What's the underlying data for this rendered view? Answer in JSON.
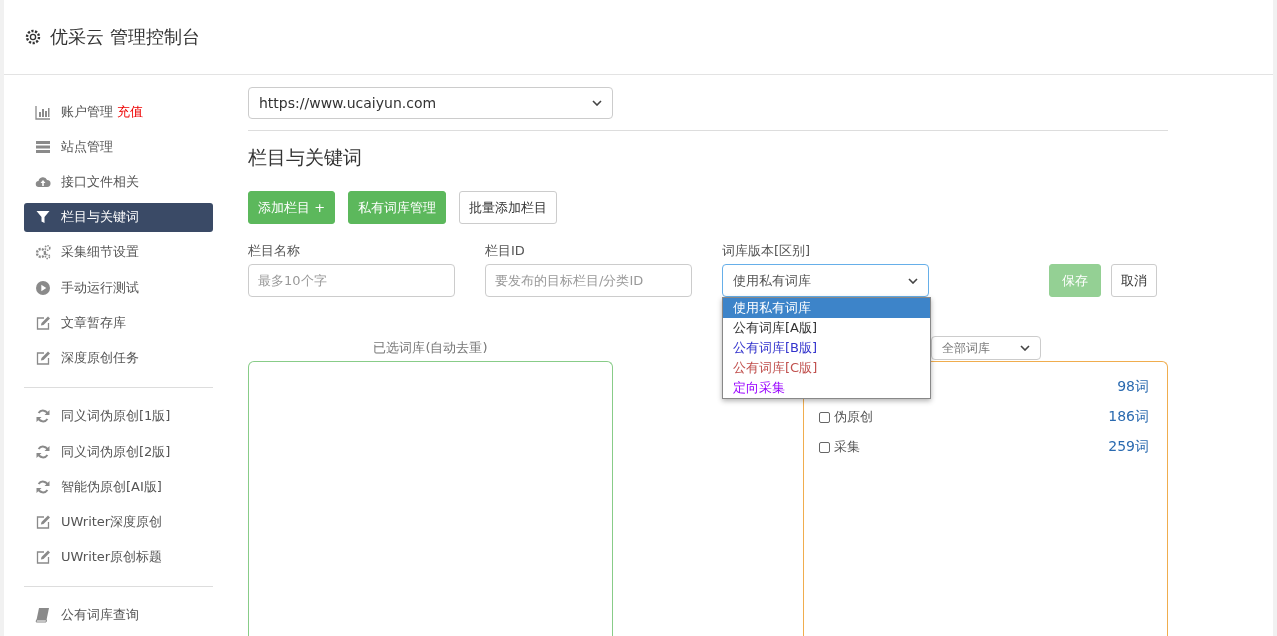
{
  "header": {
    "title": "优采云 管理控制台"
  },
  "sidebar": {
    "items": [
      {
        "kind": "bars",
        "label": "账户管理",
        "badge": "充值",
        "selected": false
      },
      {
        "kind": "server",
        "label": "站点管理",
        "selected": false
      },
      {
        "kind": "cloud",
        "label": "接口文件相关",
        "selected": false
      },
      {
        "kind": "filter",
        "label": "栏目与关键词",
        "selected": true
      },
      {
        "kind": "gears",
        "label": "采集细节设置",
        "selected": false
      },
      {
        "kind": "play",
        "label": "手动运行测试",
        "selected": false
      },
      {
        "kind": "edit",
        "label": "文章暂存库",
        "selected": false
      },
      {
        "kind": "edit",
        "label": "深度原创任务",
        "selected": false
      },
      {
        "kind": "divider"
      },
      {
        "kind": "refresh",
        "label": "同义词伪原创[1版]",
        "selected": false
      },
      {
        "kind": "refresh",
        "label": "同义词伪原创[2版]",
        "selected": false
      },
      {
        "kind": "refresh",
        "label": "智能伪原创[AI版]",
        "selected": false
      },
      {
        "kind": "edit",
        "label": "UWriter深度原创",
        "selected": false
      },
      {
        "kind": "edit",
        "label": "UWriter原创标题",
        "selected": false
      },
      {
        "kind": "divider"
      },
      {
        "kind": "book",
        "label": "公有词库查询",
        "selected": false
      }
    ]
  },
  "site_select": {
    "value": "https://www.ucaiyun.com"
  },
  "section_title": "栏目与关键词",
  "toolbar": [
    {
      "kind": "primary",
      "label": "添加栏目 +"
    },
    {
      "kind": "primary",
      "label": "私有词库管理"
    },
    {
      "kind": "default",
      "label": "批量添加栏目"
    }
  ],
  "form": {
    "fields": [
      {
        "label": "栏目名称",
        "placeholder": "最多10个字"
      },
      {
        "label": "栏目ID",
        "placeholder": "要发布的目标栏目/分类ID"
      }
    ],
    "library": {
      "label": "词库版本[区别]",
      "value": "使用私有词库",
      "open": true,
      "options": [
        {
          "label": "使用私有词库",
          "selected": true
        },
        {
          "label": "公有词库[A版]",
          "selected": false
        },
        {
          "label": "公有词库[B版]",
          "selected": false,
          "color": "#3333cc"
        },
        {
          "label": "公有词库[C版]",
          "selected": false,
          "color": "#c0504d"
        },
        {
          "label": "定向采集",
          "selected": false,
          "color": "#9900ff"
        }
      ]
    },
    "buttons": [
      {
        "kind": "save",
        "label": "保存",
        "disabled": true
      },
      {
        "kind": "cancel",
        "label": "取消",
        "disabled": false
      }
    ]
  },
  "selected_panel": {
    "title": "已选词库(自动去重)"
  },
  "library_panel": {
    "filter": "全部词库",
    "rows": [
      {
        "count": "98词"
      },
      {
        "label": "伪原创",
        "count": "186词",
        "checked": false
      },
      {
        "label": "采集",
        "count": "259词",
        "checked": false
      }
    ]
  }
}
